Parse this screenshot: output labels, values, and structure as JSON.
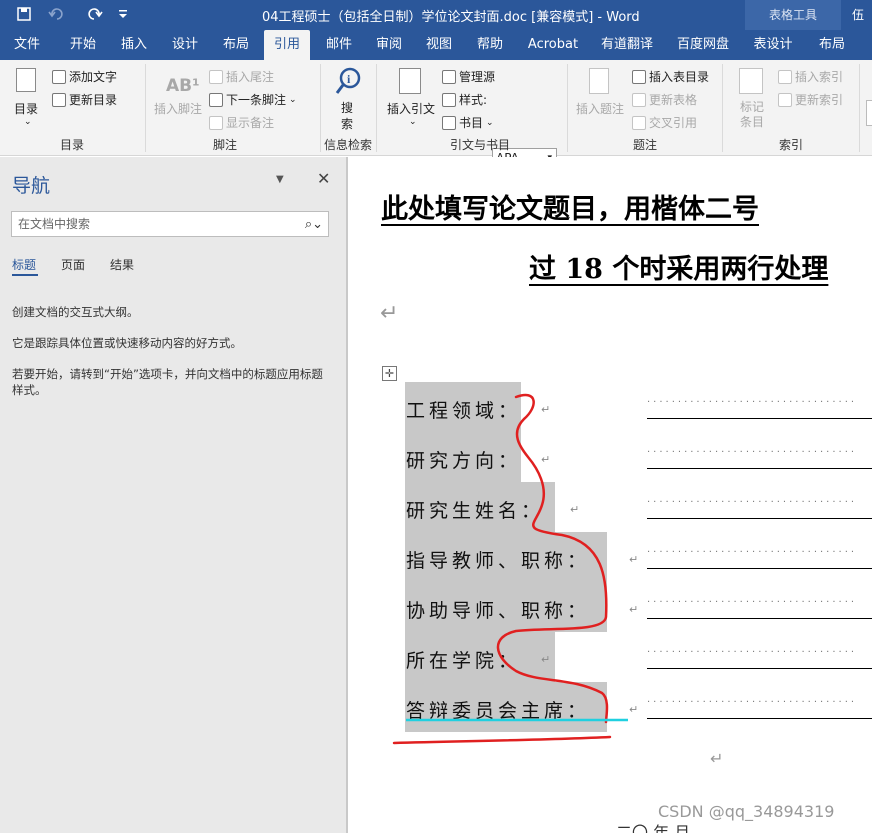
{
  "titlebar": {
    "doc_title": "04工程硕士（包括全日制）学位论文封面.doc [兼容模式] - Word",
    "table_tools": "表格工具",
    "user": "伍"
  },
  "tabs": [
    "文件",
    "开始",
    "插入",
    "设计",
    "布局",
    "引用",
    "邮件",
    "审阅",
    "视图",
    "帮助",
    "Acrobat",
    "有道翻译",
    "百度网盘",
    "表设计",
    "布局"
  ],
  "active_tab": "引用",
  "ribbon": {
    "toc_group": {
      "label": "目录",
      "toc_button": "目录",
      "add_text": "添加文字",
      "update_toc": "更新目录"
    },
    "footnote_group": {
      "label": "脚注",
      "insert_footnote": "插入脚注",
      "insert_endnote": "插入尾注",
      "next_footnote": "下一条脚注",
      "show_notes": "显示备注"
    },
    "research_group": {
      "label": "信息检索",
      "search": "搜索"
    },
    "citation_group": {
      "label": "引文与书目",
      "insert_citation": "插入引文",
      "manage_sources": "管理源",
      "style_label": "样式:",
      "style_value": "APA",
      "bibliography": "书目"
    },
    "caption_group": {
      "label": "题注",
      "insert_caption": "插入题注",
      "insert_table_of_figures": "插入表目录",
      "update_table": "更新表格",
      "cross_reference": "交叉引用"
    },
    "index_group": {
      "label": "索引",
      "mark_entry": "标记条目",
      "insert_index": "插入索引",
      "update_index": "更新索引"
    }
  },
  "nav_pane": {
    "title": "导航",
    "search_placeholder": "在文档中搜索",
    "tabs": [
      "标题",
      "页面",
      "结果"
    ],
    "msg1": "创建文档的交互式大纲。",
    "msg2": "它是跟踪具体位置或快速移动内容的好方式。",
    "msg3": "若要开始，请转到“开始”选项卡，并向文档中的标题应用标题样式。"
  },
  "document": {
    "title_line1": "此处填写论文题目，用楷体二号",
    "title_line2": "过 18 个时采用两行处理",
    "paragraph_mark": "↵",
    "fields": [
      "工程领域：",
      "研究方向：",
      "研究生姓名：",
      "指导教师、职称：",
      "协助导师、职称：",
      "所在学院：",
      "答辩委员会主席："
    ],
    "fill_dots": "··································",
    "date_partial": "二〇    年    月"
  },
  "watermark": "CSDN @qq_34894319",
  "colors": {
    "accent": "#2b579a",
    "annotation_red": "#e02020",
    "annotation_cyan": "#20d0e0"
  }
}
